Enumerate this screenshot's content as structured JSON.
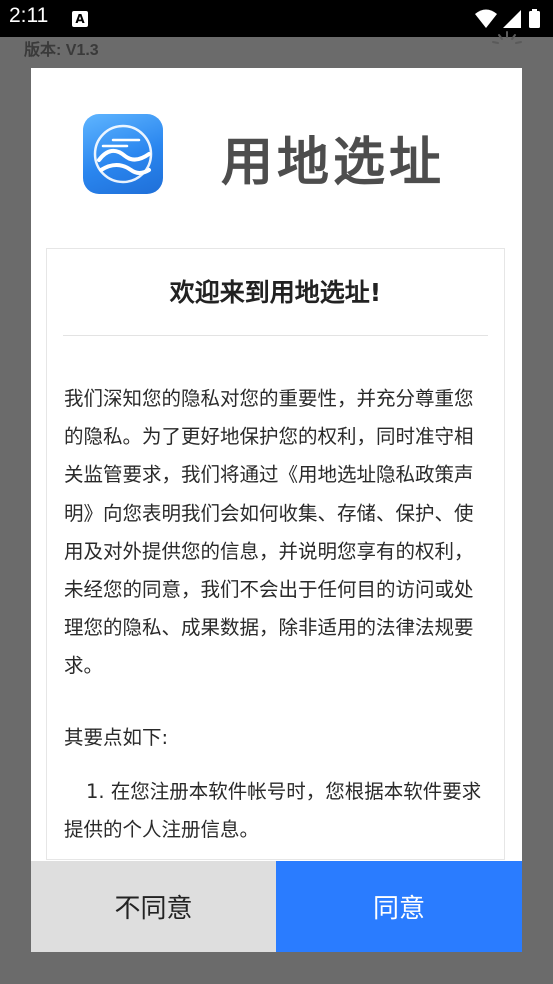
{
  "status_bar": {
    "time": "2:11",
    "notification_icon": "accessibility-a-icon",
    "icons": [
      "wifi-icon",
      "signal-icon",
      "battery-icon"
    ]
  },
  "background": {
    "version_text": "版本: V1.3"
  },
  "dialog": {
    "app_name": "用地选址",
    "app_icon": "app-logo-icon",
    "welcome_title": "欢迎来到用地选址!",
    "paragraph": "我们深知您的隐私对您的重要性，并充分尊重您的隐私。为了更好地保护您的权利，同时准守相关监管要求，我们将通过《用地选址隐私政策声明》向您表明我们会如何收集、存储、保护、使用及对外提供您的信息，并说明您享有的权利，未经您的同意，我们不会出于任何目的访问或处理您的隐私、成果数据，除非适用的法律法规要求。",
    "section_label": "其要点如下:",
    "list_item_1": "1. 在您注册本软件帐号时，您根据本软件要求提供的个人注册信息。",
    "disagree_label": "不同意",
    "agree_label": "同意"
  },
  "colors": {
    "overlay": "#6b6b6b",
    "agree_button": "#2a7cff",
    "disagree_button": "#dedede",
    "app_name_text": "#4d4d4d"
  }
}
